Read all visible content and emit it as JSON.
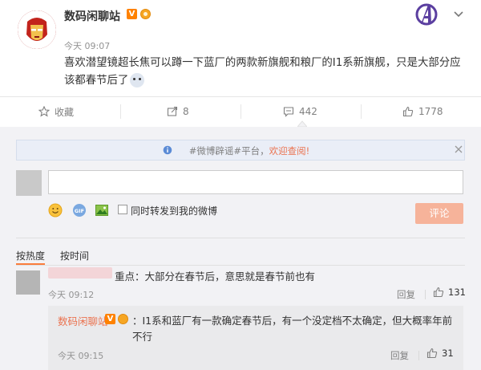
{
  "post": {
    "author": "数码闲聊站",
    "verified_badge": "V",
    "time": "今天 09:07",
    "content": "喜欢潜望镜超长焦可以蹲一下蓝厂的两款新旗舰和粮厂的I1系新旗舰，只是大部分应该都春节后了",
    "actions": {
      "favorite": "收藏",
      "repost": "8",
      "comment": "442",
      "like": "1778"
    }
  },
  "comments_panel": {
    "notice_text": "#微博辟谣#平台，",
    "notice_link": "欢迎查阅!",
    "also_repost_label": "同时转发到我的微博",
    "submit_label": "评论",
    "sort_hot": "按热度",
    "sort_time": "按时间"
  },
  "comment1": {
    "text": "重点：大部分在春节后，意思就是春节前也有",
    "time": "今天 09:12",
    "reply_label": "回复",
    "likes": "131"
  },
  "reply1": {
    "author": "数码闲聊站",
    "verified_badge": "V",
    "text": "：I1系和蓝厂有一款确定春节后，有一个没定档不太确定，但大概率年前不行",
    "time": "今天 09:15",
    "reply_label": "回复",
    "likes": "31"
  },
  "colors": {
    "accent": "#eb7350",
    "badge": "#ff8200",
    "button": "#f6b39a"
  },
  "icons": [
    "avatar-iron-man",
    "avengers-logo",
    "chevron-down-icon",
    "star-icon",
    "repost-icon",
    "comment-icon",
    "thumb-up-icon",
    "info-icon",
    "close-icon",
    "smile-icon",
    "gif-icon",
    "image-icon"
  ]
}
